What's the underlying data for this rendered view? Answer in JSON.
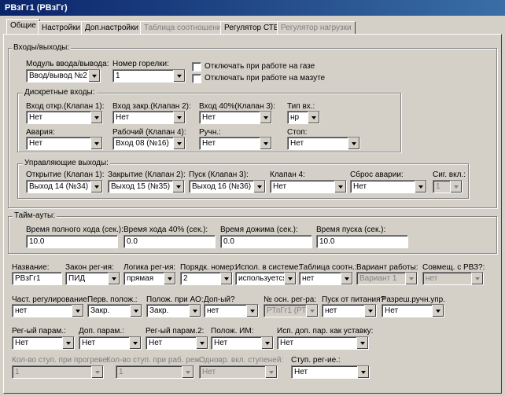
{
  "window": {
    "title": "РВзГг1 (РВзГг)"
  },
  "tabs": [
    "Общие",
    "Настройки",
    "Доп.настройки",
    "Таблица соотношения",
    "Регулятор СТВ",
    "Регулятор нагрузки"
  ],
  "io": {
    "title": "Входы/выходы:",
    "module_label": "Модуль ввода/вывода:",
    "module_value": "Ввод/вывод №2",
    "burner_label": "Номер горелки:",
    "burner_value": "1",
    "gas_off": "Отключать при работе на газе",
    "oil_off": "Отключать при работе на мазуте",
    "discrete": {
      "title": "Дискретные входы:",
      "open_label": "Вход откр.(Клапан 1):",
      "open_value": "Нет",
      "close_label": "Вход закр.(Клапан 2):",
      "close_value": "Нет",
      "in40_label": "Вход 40%(Клапан 3):",
      "in40_value": "Нет",
      "type_label": "Тип вх.:",
      "type_value": "нр",
      "alarm_label": "Авария:",
      "alarm_value": "Нет",
      "work_label": "Рабочий (Клапан 4):",
      "work_value": "Вход 08 (№16)",
      "manual_label": "Ручн.:",
      "manual_value": "Нет",
      "stop_label": "Стоп:",
      "stop_value": "Нет"
    },
    "outputs": {
      "title": "Управляющие выходы:",
      "open_label": "Открытие (Клапан 1):",
      "open_value": "Выход 14 (№34)",
      "close_label": "Закрытие (Клапан 2):",
      "close_value": "Выход 15 (№35)",
      "start_label": "Пуск (Клапан 3):",
      "start_value": "Выход 16 (№36)",
      "valve4_label": "Клапан 4:",
      "valve4_value": "Нет",
      "reset_label": "Сброс аварии:",
      "reset_value": "Нет",
      "sig_label": "Сиг. вкл.:",
      "sig_value": "1"
    }
  },
  "timeouts": {
    "title": "Тайм-ауты:",
    "full_label": "Время полного хода (сек.):",
    "full_value": "10.0",
    "t40_label": "Время хода 40% (сек.):",
    "t40_value": "0.0",
    "press_label": "Время дожима (сек.):",
    "press_value": "0.0",
    "start_label": "Время пуска (сек.):",
    "start_value": "10.0"
  },
  "row1": {
    "name_label": "Название:",
    "name_value": "РВзГг1",
    "law_label": "Закон рег-ия:",
    "law_value": "ПИД",
    "logic_label": "Логика рег-ия:",
    "logic_value": "прямая",
    "order_label": "Порядк. номер:",
    "order_value": "2",
    "use_label": "Испол. в системе:",
    "use_value": "используется",
    "table_label": "Таблица соотн.:",
    "table_value": "нет",
    "variant_label": "Вариант работы:",
    "variant_value": "Вариант 1",
    "combine_label": "Совмещ. с РВЗ?:",
    "combine_value": "нет"
  },
  "row2": {
    "freq_label": "Част. регулирование:",
    "freq_value": "нет",
    "firstpos_label": "Перв. полож.:",
    "firstpos_value": "Закр.",
    "ao_label": "Полож. при АО:",
    "ao_value": "Закр.",
    "add_label": "Доп-ый?",
    "add_value": "нет",
    "regnum_label": "№ осн. рег-ра:",
    "regnum_value": "РТпГг1 (РТп",
    "power_label": "Пуск от питания?",
    "power_value": "нет",
    "manual_label": "Разреш.ручн.упр.",
    "manual_value": "Нет"
  },
  "row3": {
    "param_label": "Рег-ый парам.:",
    "param_value": "Нет",
    "addparam_label": "Доп. парам.:",
    "addparam_value": "Нет",
    "param2_label": "Рег-ый парам.2:",
    "param2_value": "Нет",
    "im_label": "Полож. ИМ:",
    "im_value": "Нет",
    "setpoint_label": "Исп. доп. пар. как уставку:",
    "setpoint_value": "Нет"
  },
  "row4": {
    "warm_label": "Кол-во ступ. при прогреве:",
    "warm_value": "1",
    "mode_label": "Кол-во ступ. при раб. реж.:",
    "mode_value": "1",
    "simul_label": "Одновр. вкл. ступеней:",
    "simul_value": "Нет",
    "step_label": "Ступ. рег-ие.:",
    "step_value": "Нет"
  }
}
